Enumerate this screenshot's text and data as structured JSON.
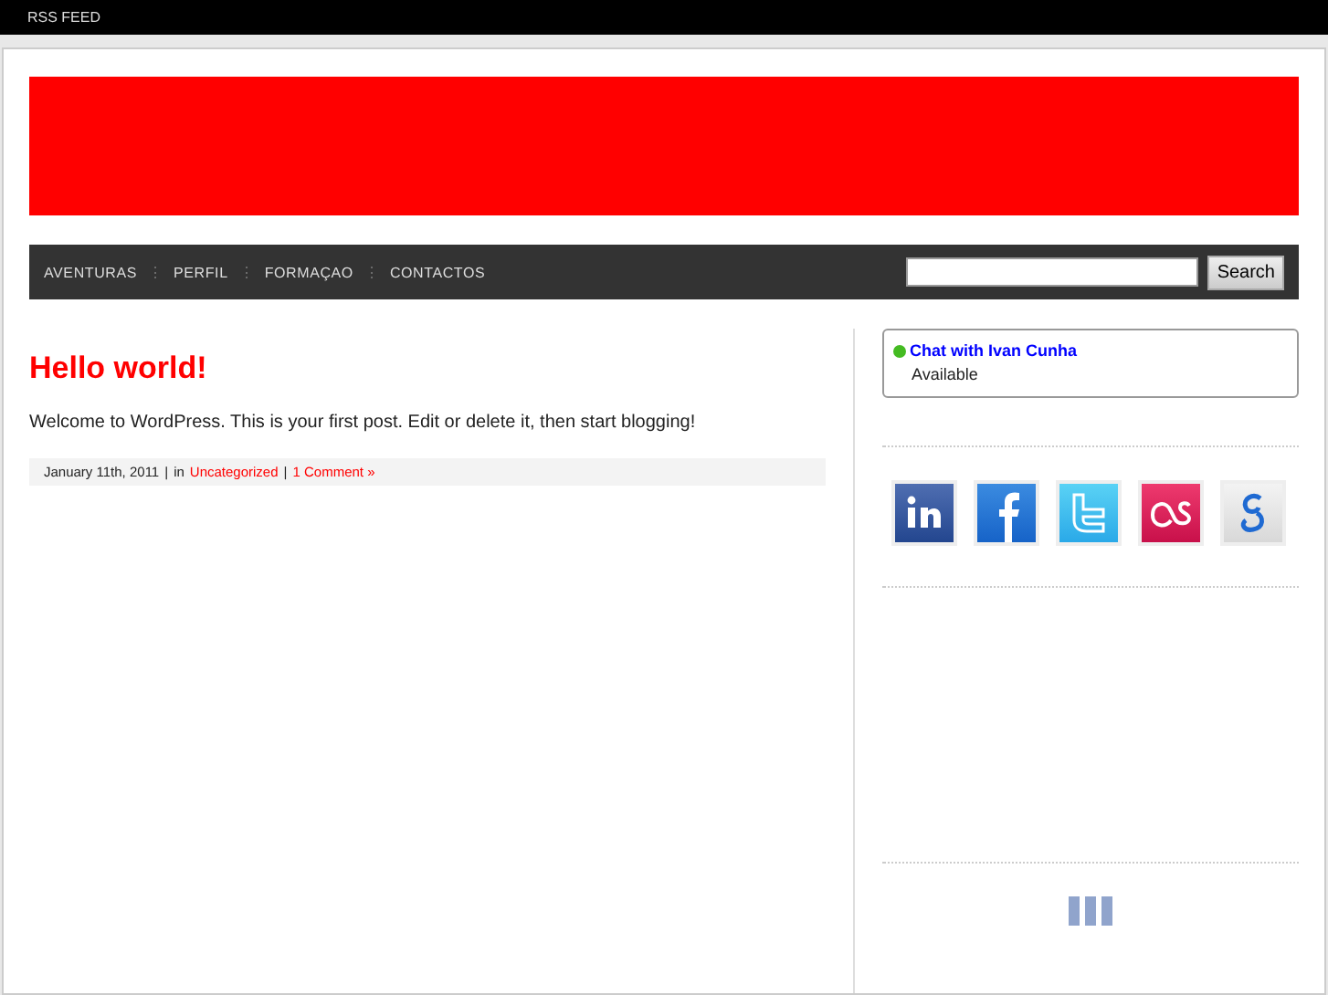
{
  "top_bar": {
    "link": "RSS FEED"
  },
  "nav": {
    "items": [
      {
        "label": "AVENTURAS"
      },
      {
        "label": "PERFIL"
      },
      {
        "label": "FORMAÇAO"
      },
      {
        "label": "CONTACTOS"
      }
    ],
    "separator": "⋮"
  },
  "search": {
    "button": "Search"
  },
  "post": {
    "title": "Hello world!",
    "body": "Welcome to WordPress. This is your first post. Edit or delete it, then start blogging!",
    "date": "January 11th, 2011",
    "sep1": "|",
    "in": "in",
    "category": "Uncategorized",
    "sep2": "|",
    "comments": "1 Comment »"
  },
  "chat": {
    "title": "Chat with Ivan Cunha",
    "status": "Available",
    "color": "#44bb22"
  },
  "social": [
    {
      "kind": "linkedin"
    },
    {
      "kind": "facebook"
    },
    {
      "kind": "twitter"
    },
    {
      "kind": "lastfm"
    },
    {
      "kind": "google"
    }
  ]
}
